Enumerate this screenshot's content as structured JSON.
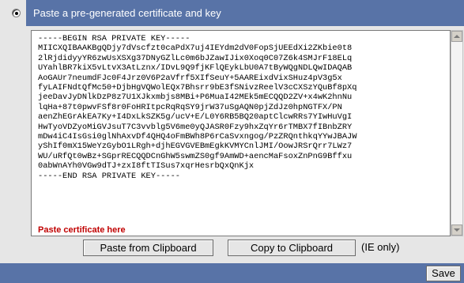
{
  "header": {
    "title": "Paste a pre-generated certificate and key"
  },
  "certificate_textarea": {
    "lines": [
      "-----BEGIN RSA PRIVATE KEY-----",
      "MIICXQIBAAKBgQDjy7dVscfzt0caPdX7uj4IEYdm2dV0FopSjUEEdXi2ZKbie0t8",
      "2lRjdidyyYR6zwUsXSXg37DNyGZlLc0m6bJZawIJix0Xoq0C07Z6k4SMJrF18ELq",
      "UYahlBR7kiX5vLtvX3AtLznx/IDvL9Q9fjKFlQEykLbU0A7tByWQgNDLQwIDAQAB",
      "AoGAUr7neumdFJc0F4Jrz0V6P2aVfrf5XIfSeuY+5AAREixdVixSHuz4pV3g5x",
      "fyLAIFNdtQfMc50+DjbHgVQWolEQx7Bhsrr9bE3fSNivzReelV3cCXSzYQuBf8pXq",
      "jeeDavJyDNlkDzP8z7U1XJkxmbjs8MBi+P6MuaI42MEk5mECQQD2ZV+x4wK2hnNu",
      "lqHa+87t0pwvFSf8r0FoHRItpcRqRqSY9jrW37uSgAQN0pjZdJz0hpNGTFX/PN",
      "aenZhEGrAkEA7Ky+I4DxLkSZK5g/ucV+E/L0Y6RB5BQ20aptClcwRRs7YIwHuVgI",
      "HwTyoVDZyoMiGVJsuT7C3vvblg5V6me0yQJASR0Fzy9hxZqYr6rTMBX7fIBnbZRY",
      "mDw4iC4IsGsi0glNhAxvDf4QHQ4oFmBWh8P6rCaSvxngog/PzZRQnthkqYYwJBAJW",
      "yShIf0mX15WeYzGybO1LRgh+djhEGVGVEBmEgkKVMYCnlJMI/OowJRSrQrr7LWz7",
      "WU/uRfQt0wBz+SGprRECQQDCnGhW5swmZS0gf9AmWD+aencMaFsoxZnPnG9Bffxu",
      "0abWnAYh0VGw9dTJ+zxI8ftTISus7xqrHesrbQxQnKjx",
      "-----END RSA PRIVATE KEY-----"
    ],
    "hint": "Paste certificate here"
  },
  "buttons": {
    "paste": "Paste from Clipboard",
    "copy": "Copy to Clipboard",
    "ie_only": "(IE only)",
    "save": "Save"
  },
  "colors": {
    "header_bg": "#5873a7",
    "panel_bg": "#e6e6e6",
    "hint_red": "#c00000"
  }
}
